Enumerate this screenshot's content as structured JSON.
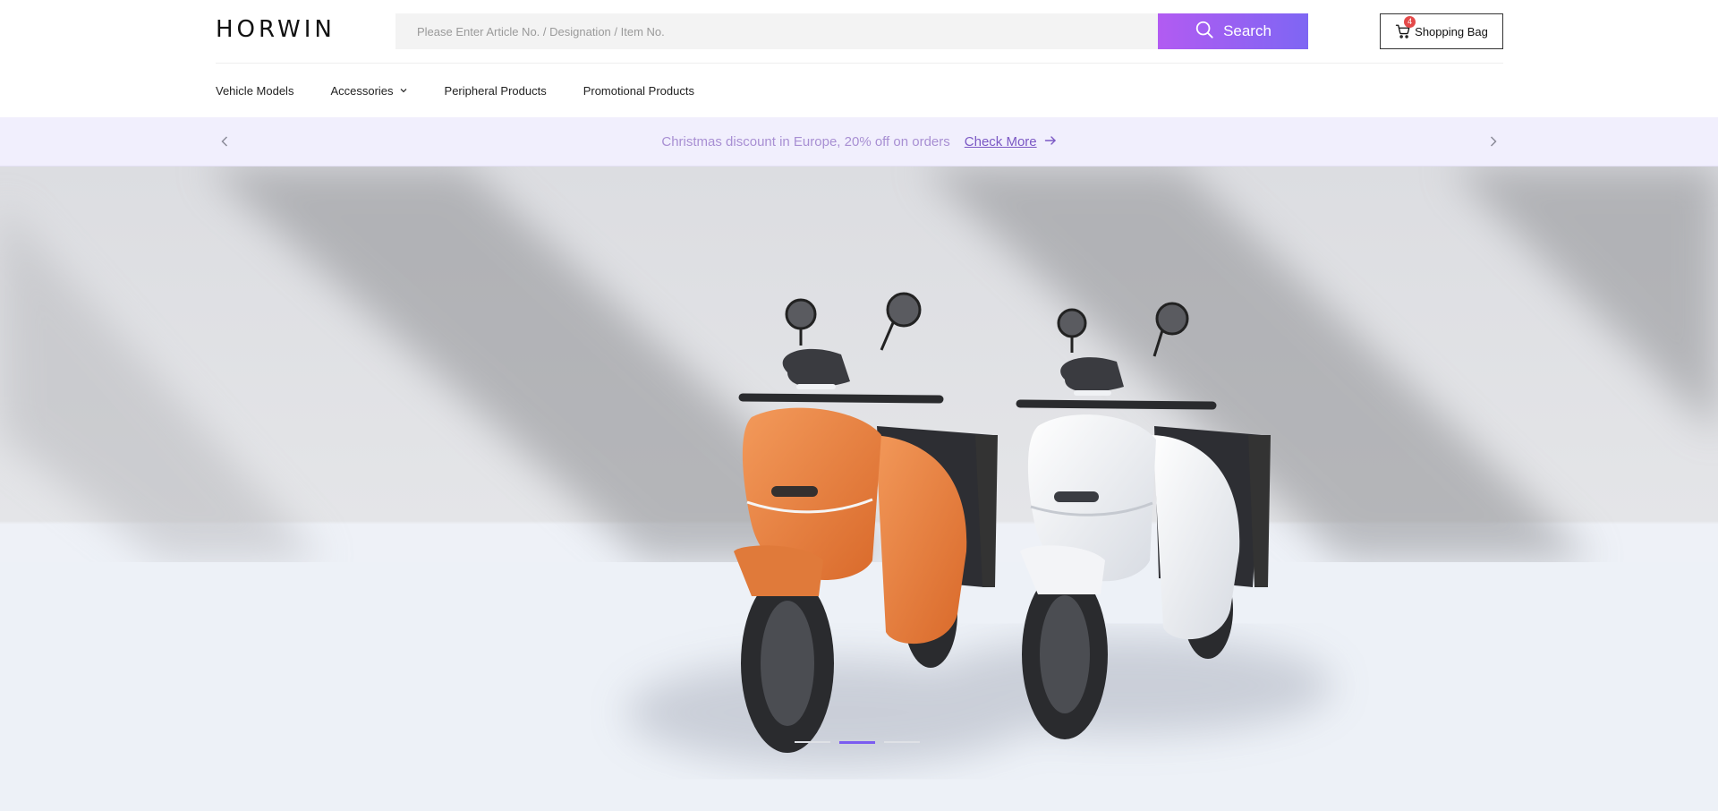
{
  "brand": {
    "logo_text": "HORWIN"
  },
  "search": {
    "placeholder": "Please Enter Article No. / Designation / Item No.",
    "value": "",
    "button_label": "Search",
    "button_icon": "search-icon"
  },
  "bag": {
    "label": "Shopping Bag",
    "count": "4",
    "icon": "cart-icon"
  },
  "nav": {
    "items": [
      {
        "label": "Vehicle Models"
      },
      {
        "label": "Accessories",
        "has_dropdown": true
      },
      {
        "label": "Peripheral Products"
      },
      {
        "label": "Promotional Products"
      }
    ]
  },
  "promo": {
    "text": "Christmas discount in Europe, 20% off on orders",
    "link_label": "Check More"
  },
  "hero": {
    "slides_total": 3,
    "active_slide": 2
  },
  "colors": {
    "accent_start": "#b25bf2",
    "accent_end": "#7e66f3",
    "promo_bg": "#f1effd",
    "promo_text": "#a88fd3",
    "promo_link": "#7b58c4",
    "badge": "#e44a4a",
    "dot_active": "#7b5cf0"
  }
}
